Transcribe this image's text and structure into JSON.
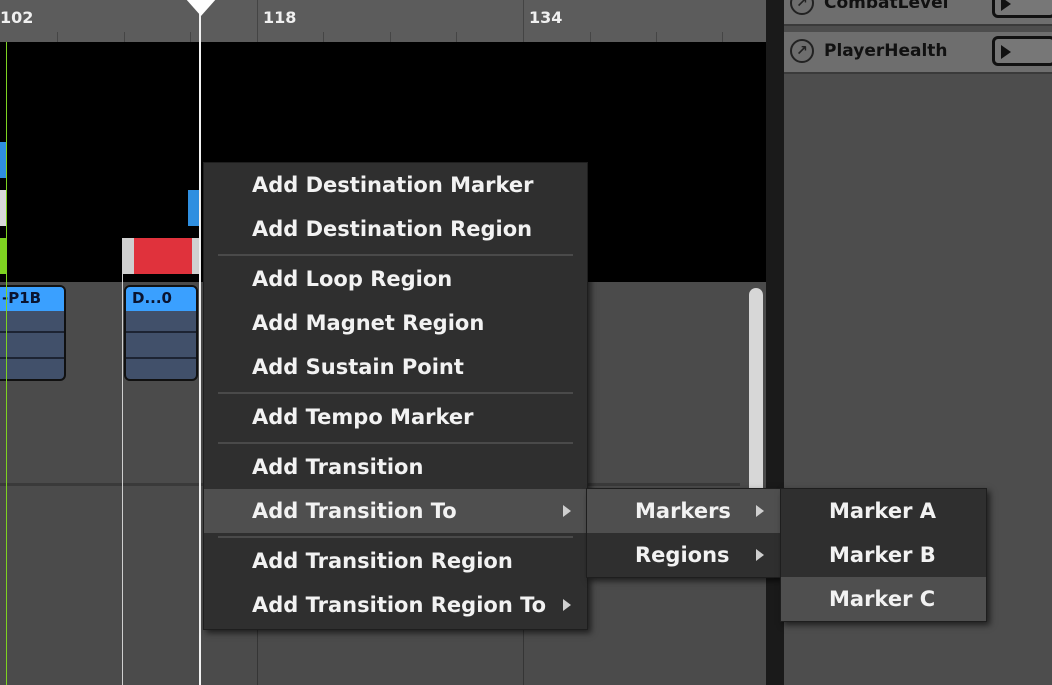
{
  "ruler": {
    "labels": [
      "102",
      "118",
      "134"
    ]
  },
  "clips": [
    {
      "label": "-P1B"
    },
    {
      "label": "D...0"
    }
  ],
  "parameters": [
    {
      "name": "CombatLevel"
    },
    {
      "name": "PlayerHealth"
    }
  ],
  "context_menu": {
    "items": [
      "Add Destination Marker",
      "Add Destination Region",
      "Add Loop Region",
      "Add Magnet Region",
      "Add Sustain Point",
      "Add Tempo Marker",
      "Add Transition",
      "Add Transition To",
      "Add Transition Region",
      "Add Transition Region To"
    ],
    "highlighted": "Add Transition To"
  },
  "submenu": {
    "items": [
      "Markers",
      "Regions"
    ],
    "highlighted": "Markers"
  },
  "submenu2": {
    "items": [
      "Marker A",
      "Marker B",
      "Marker C"
    ],
    "highlighted": "Marker C"
  },
  "colors": {
    "clip_header": "#3aa0ff",
    "marker_red": "#e0323c",
    "marker_blue": "#2f8fe0",
    "marker_green": "#7ed321",
    "menu_bg": "#2f2f2f",
    "menu_highlight": "#4f4f4f"
  }
}
